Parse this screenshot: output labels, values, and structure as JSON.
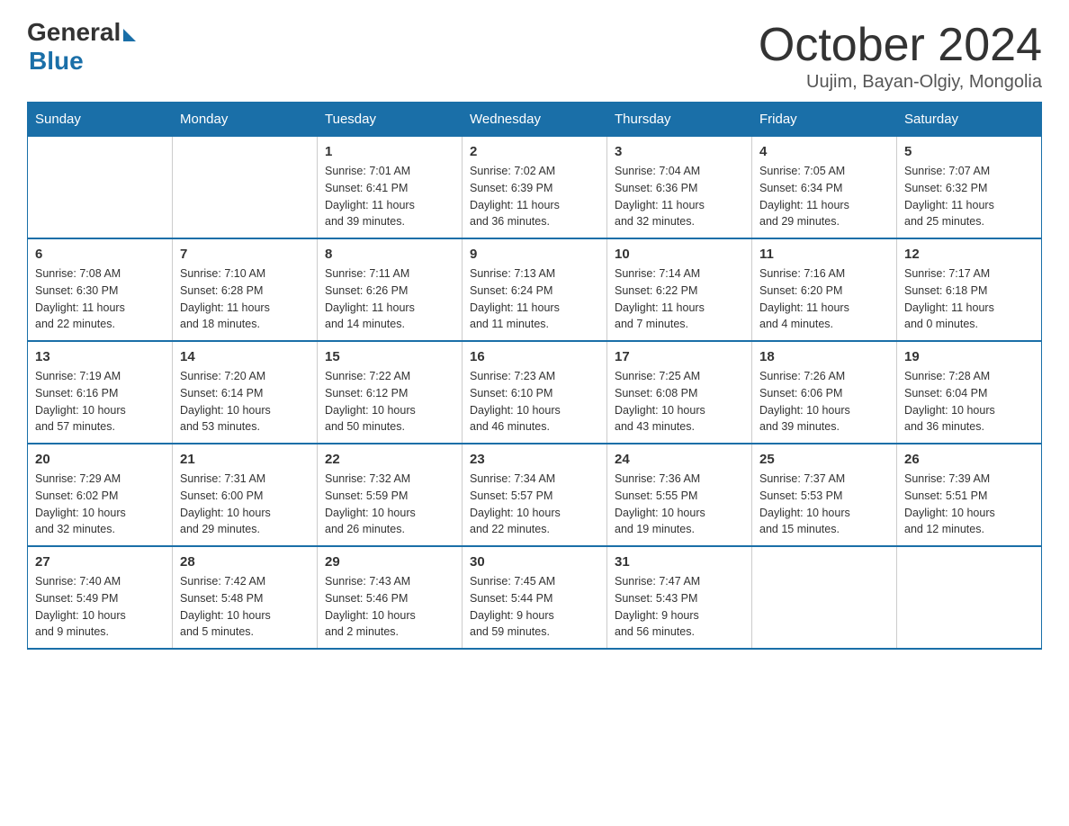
{
  "header": {
    "logo": {
      "general": "General",
      "blue": "Blue"
    },
    "title": "October 2024",
    "location": "Uujim, Bayan-Olgiy, Mongolia"
  },
  "days_of_week": [
    "Sunday",
    "Monday",
    "Tuesday",
    "Wednesday",
    "Thursday",
    "Friday",
    "Saturday"
  ],
  "weeks": [
    [
      {
        "day": "",
        "info": ""
      },
      {
        "day": "",
        "info": ""
      },
      {
        "day": "1",
        "info": "Sunrise: 7:01 AM\nSunset: 6:41 PM\nDaylight: 11 hours\nand 39 minutes."
      },
      {
        "day": "2",
        "info": "Sunrise: 7:02 AM\nSunset: 6:39 PM\nDaylight: 11 hours\nand 36 minutes."
      },
      {
        "day": "3",
        "info": "Sunrise: 7:04 AM\nSunset: 6:36 PM\nDaylight: 11 hours\nand 32 minutes."
      },
      {
        "day": "4",
        "info": "Sunrise: 7:05 AM\nSunset: 6:34 PM\nDaylight: 11 hours\nand 29 minutes."
      },
      {
        "day": "5",
        "info": "Sunrise: 7:07 AM\nSunset: 6:32 PM\nDaylight: 11 hours\nand 25 minutes."
      }
    ],
    [
      {
        "day": "6",
        "info": "Sunrise: 7:08 AM\nSunset: 6:30 PM\nDaylight: 11 hours\nand 22 minutes."
      },
      {
        "day": "7",
        "info": "Sunrise: 7:10 AM\nSunset: 6:28 PM\nDaylight: 11 hours\nand 18 minutes."
      },
      {
        "day": "8",
        "info": "Sunrise: 7:11 AM\nSunset: 6:26 PM\nDaylight: 11 hours\nand 14 minutes."
      },
      {
        "day": "9",
        "info": "Sunrise: 7:13 AM\nSunset: 6:24 PM\nDaylight: 11 hours\nand 11 minutes."
      },
      {
        "day": "10",
        "info": "Sunrise: 7:14 AM\nSunset: 6:22 PM\nDaylight: 11 hours\nand 7 minutes."
      },
      {
        "day": "11",
        "info": "Sunrise: 7:16 AM\nSunset: 6:20 PM\nDaylight: 11 hours\nand 4 minutes."
      },
      {
        "day": "12",
        "info": "Sunrise: 7:17 AM\nSunset: 6:18 PM\nDaylight: 11 hours\nand 0 minutes."
      }
    ],
    [
      {
        "day": "13",
        "info": "Sunrise: 7:19 AM\nSunset: 6:16 PM\nDaylight: 10 hours\nand 57 minutes."
      },
      {
        "day": "14",
        "info": "Sunrise: 7:20 AM\nSunset: 6:14 PM\nDaylight: 10 hours\nand 53 minutes."
      },
      {
        "day": "15",
        "info": "Sunrise: 7:22 AM\nSunset: 6:12 PM\nDaylight: 10 hours\nand 50 minutes."
      },
      {
        "day": "16",
        "info": "Sunrise: 7:23 AM\nSunset: 6:10 PM\nDaylight: 10 hours\nand 46 minutes."
      },
      {
        "day": "17",
        "info": "Sunrise: 7:25 AM\nSunset: 6:08 PM\nDaylight: 10 hours\nand 43 minutes."
      },
      {
        "day": "18",
        "info": "Sunrise: 7:26 AM\nSunset: 6:06 PM\nDaylight: 10 hours\nand 39 minutes."
      },
      {
        "day": "19",
        "info": "Sunrise: 7:28 AM\nSunset: 6:04 PM\nDaylight: 10 hours\nand 36 minutes."
      }
    ],
    [
      {
        "day": "20",
        "info": "Sunrise: 7:29 AM\nSunset: 6:02 PM\nDaylight: 10 hours\nand 32 minutes."
      },
      {
        "day": "21",
        "info": "Sunrise: 7:31 AM\nSunset: 6:00 PM\nDaylight: 10 hours\nand 29 minutes."
      },
      {
        "day": "22",
        "info": "Sunrise: 7:32 AM\nSunset: 5:59 PM\nDaylight: 10 hours\nand 26 minutes."
      },
      {
        "day": "23",
        "info": "Sunrise: 7:34 AM\nSunset: 5:57 PM\nDaylight: 10 hours\nand 22 minutes."
      },
      {
        "day": "24",
        "info": "Sunrise: 7:36 AM\nSunset: 5:55 PM\nDaylight: 10 hours\nand 19 minutes."
      },
      {
        "day": "25",
        "info": "Sunrise: 7:37 AM\nSunset: 5:53 PM\nDaylight: 10 hours\nand 15 minutes."
      },
      {
        "day": "26",
        "info": "Sunrise: 7:39 AM\nSunset: 5:51 PM\nDaylight: 10 hours\nand 12 minutes."
      }
    ],
    [
      {
        "day": "27",
        "info": "Sunrise: 7:40 AM\nSunset: 5:49 PM\nDaylight: 10 hours\nand 9 minutes."
      },
      {
        "day": "28",
        "info": "Sunrise: 7:42 AM\nSunset: 5:48 PM\nDaylight: 10 hours\nand 5 minutes."
      },
      {
        "day": "29",
        "info": "Sunrise: 7:43 AM\nSunset: 5:46 PM\nDaylight: 10 hours\nand 2 minutes."
      },
      {
        "day": "30",
        "info": "Sunrise: 7:45 AM\nSunset: 5:44 PM\nDaylight: 9 hours\nand 59 minutes."
      },
      {
        "day": "31",
        "info": "Sunrise: 7:47 AM\nSunset: 5:43 PM\nDaylight: 9 hours\nand 56 minutes."
      },
      {
        "day": "",
        "info": ""
      },
      {
        "day": "",
        "info": ""
      }
    ]
  ]
}
